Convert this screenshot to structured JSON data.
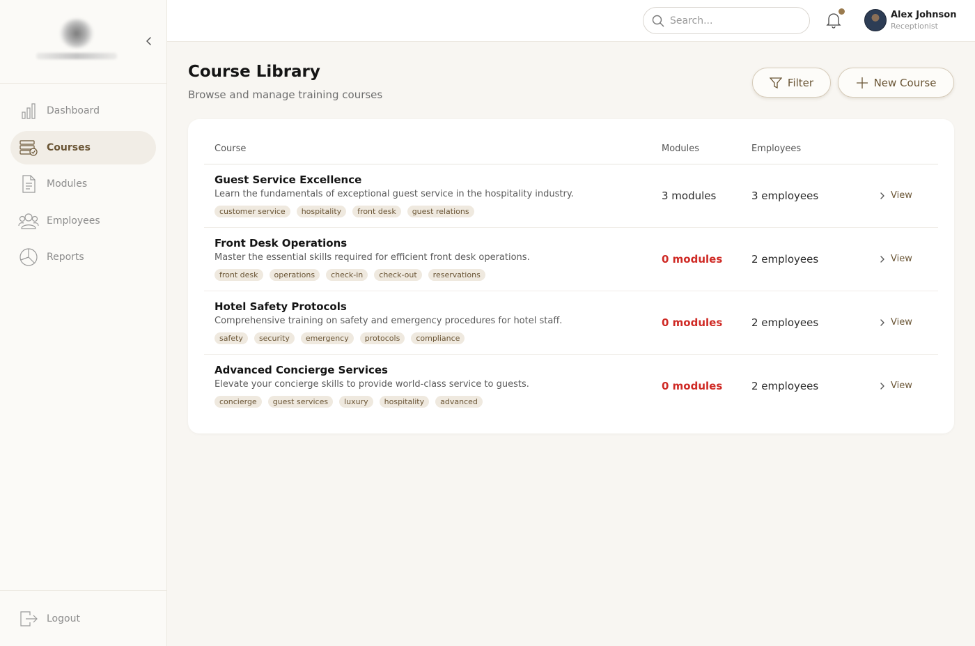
{
  "sidebar": {
    "items": [
      {
        "label": "Dashboard",
        "icon": "bar-chart-icon"
      },
      {
        "label": "Courses",
        "icon": "books-icon",
        "active": true
      },
      {
        "label": "Modules",
        "icon": "document-icon"
      },
      {
        "label": "Employees",
        "icon": "users-icon"
      },
      {
        "label": "Reports",
        "icon": "pie-chart-icon"
      }
    ],
    "logout_label": "Logout"
  },
  "header": {
    "search_placeholder": "Search...",
    "user": {
      "name": "Alex Johnson",
      "role": "Receptionist"
    },
    "notification_dot_color": "#9a7b4f"
  },
  "page": {
    "title": "Course Library",
    "subtitle": "Browse and manage training courses",
    "filter_label": "Filter",
    "new_course_label": "New Course"
  },
  "table": {
    "headers": {
      "course": "Course",
      "modules": "Modules",
      "employees": "Employees"
    },
    "rows": [
      {
        "name": "Guest Service Excellence",
        "description": "Learn the fundamentals of exceptional guest service in the hospitality industry.",
        "tags": [
          "customer service",
          "hospitality",
          "front desk",
          "guest relations"
        ],
        "modules": "3 modules",
        "employees": "3 employees",
        "action": "View"
      },
      {
        "name": "Front Desk Operations",
        "description": "Master the essential skills required for efficient front desk operations.",
        "tags": [
          "front desk",
          "operations",
          "check-in",
          "check-out",
          "reservations"
        ],
        "modules": "0 modules",
        "employees": "2 employees",
        "action": "View"
      },
      {
        "name": "Hotel Safety Protocols",
        "description": "Comprehensive training on safety and emergency procedures for hotel staff.",
        "tags": [
          "safety",
          "security",
          "emergency",
          "protocols",
          "compliance"
        ],
        "modules": "0 modules",
        "employees": "2 employees",
        "action": "View"
      },
      {
        "name": "Advanced Concierge Services",
        "description": "Elevate your concierge skills to provide world-class service to guests.",
        "tags": [
          "concierge",
          "guest services",
          "luxury",
          "hospitality",
          "advanced"
        ],
        "modules": "0 modules",
        "employees": "2 employees",
        "action": "View"
      }
    ]
  },
  "colors": {
    "accent": "#6a5535",
    "warning": "#cf2a25",
    "tag_bg": "#efe9df",
    "page_bg": "#f8f6f2"
  }
}
